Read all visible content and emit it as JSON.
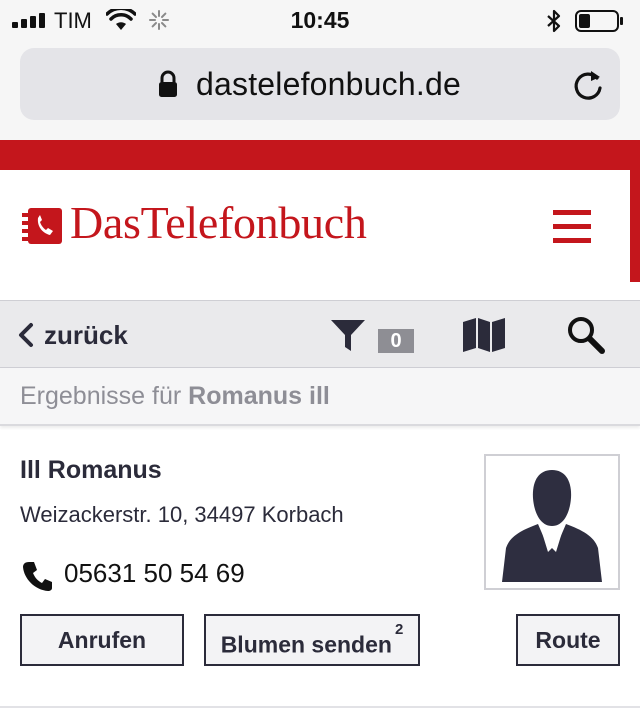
{
  "status_bar": {
    "carrier": "TIM",
    "time": "10:45",
    "battery_level": 0.3
  },
  "browser": {
    "url": "dastelefonbuch.de"
  },
  "header": {
    "logo_text": "DasTelefonbuch",
    "brand_color": "#c4161c"
  },
  "toolbar": {
    "back_label": "zurück",
    "filter_count": "0",
    "icons": [
      "chevron-left-icon",
      "filter-icon",
      "map-icon",
      "search-icon"
    ]
  },
  "results": {
    "prefix": "Ergebnisse für",
    "query": "Romanus ill"
  },
  "entry": {
    "name": "Ill Romanus",
    "address": "Weizackerstr. 10, 34497 Korbach",
    "phone": "05631 50 54 69",
    "buttons": {
      "call": "Anrufen",
      "flowers": "Blumen senden",
      "flowers_footnote": "2",
      "route": "Route"
    }
  }
}
